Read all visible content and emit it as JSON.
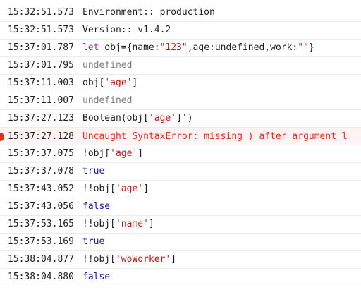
{
  "console": {
    "rows": [
      {
        "ts": "15:32:51.573",
        "parts": [
          {
            "t": "Environment:: production",
            "c": "default"
          }
        ]
      },
      {
        "ts": "15:32:51.573",
        "parts": [
          {
            "t": "Version:: v1.4.2",
            "c": "default"
          }
        ]
      },
      {
        "ts": "15:37:01.787",
        "parts": [
          {
            "t": "let",
            "c": "kw"
          },
          {
            "t": " obj={name:",
            "c": "default"
          },
          {
            "t": "\"123\"",
            "c": "str"
          },
          {
            "t": ",age:undefined,work:",
            "c": "default"
          },
          {
            "t": "\"\"",
            "c": "str"
          },
          {
            "t": "}",
            "c": "default"
          }
        ]
      },
      {
        "ts": "15:37:01.795",
        "parts": [
          {
            "t": "undefined",
            "c": "undef"
          }
        ]
      },
      {
        "ts": "15:37:11.003",
        "parts": [
          {
            "t": "obj[",
            "c": "default"
          },
          {
            "t": "'age'",
            "c": "str"
          },
          {
            "t": "]",
            "c": "default"
          }
        ]
      },
      {
        "ts": "15:37:11.007",
        "parts": [
          {
            "t": "undefined",
            "c": "undef"
          }
        ]
      },
      {
        "ts": "15:37:27.123",
        "parts": [
          {
            "t": "Boolean(obj[",
            "c": "default"
          },
          {
            "t": "'age'",
            "c": "str"
          },
          {
            "t": "]')",
            "c": "default"
          }
        ]
      },
      {
        "ts": "15:37:27.128",
        "error": true,
        "parts": [
          {
            "t": "Uncaught SyntaxError: missing ) after argument l",
            "c": "err"
          }
        ]
      },
      {
        "ts": "15:37:37.075",
        "parts": [
          {
            "t": "!obj[",
            "c": "default"
          },
          {
            "t": "'age'",
            "c": "str"
          },
          {
            "t": "]",
            "c": "default"
          }
        ]
      },
      {
        "ts": "15:37:37.078",
        "parts": [
          {
            "t": "true",
            "c": "bool"
          }
        ]
      },
      {
        "ts": "15:37:43.052",
        "parts": [
          {
            "t": "!!obj[",
            "c": "default"
          },
          {
            "t": "'age'",
            "c": "str"
          },
          {
            "t": "]",
            "c": "default"
          }
        ]
      },
      {
        "ts": "15:37:43.056",
        "parts": [
          {
            "t": "false",
            "c": "bool"
          }
        ]
      },
      {
        "ts": "15:37:53.165",
        "parts": [
          {
            "t": "!!obj[",
            "c": "default"
          },
          {
            "t": "'name'",
            "c": "str"
          },
          {
            "t": "]",
            "c": "default"
          }
        ]
      },
      {
        "ts": "15:37:53.169",
        "parts": [
          {
            "t": "true",
            "c": "bool"
          }
        ]
      },
      {
        "ts": "15:38:04.877",
        "parts": [
          {
            "t": "!!obj[",
            "c": "default"
          },
          {
            "t": "'woWorker'",
            "c": "str"
          },
          {
            "t": "]",
            "c": "default"
          }
        ]
      },
      {
        "ts": "15:38:04.880",
        "parts": [
          {
            "t": "false",
            "c": "bool"
          }
        ]
      }
    ]
  },
  "colors": {
    "keyword": "#a626a4",
    "string": "#c41a16",
    "boolean": "#1a1aa6",
    "undefined": "#808080",
    "error": "#e0301e",
    "error_bg": "#fff2f2"
  },
  "icons": {
    "error_row_icon": "error-icon"
  }
}
